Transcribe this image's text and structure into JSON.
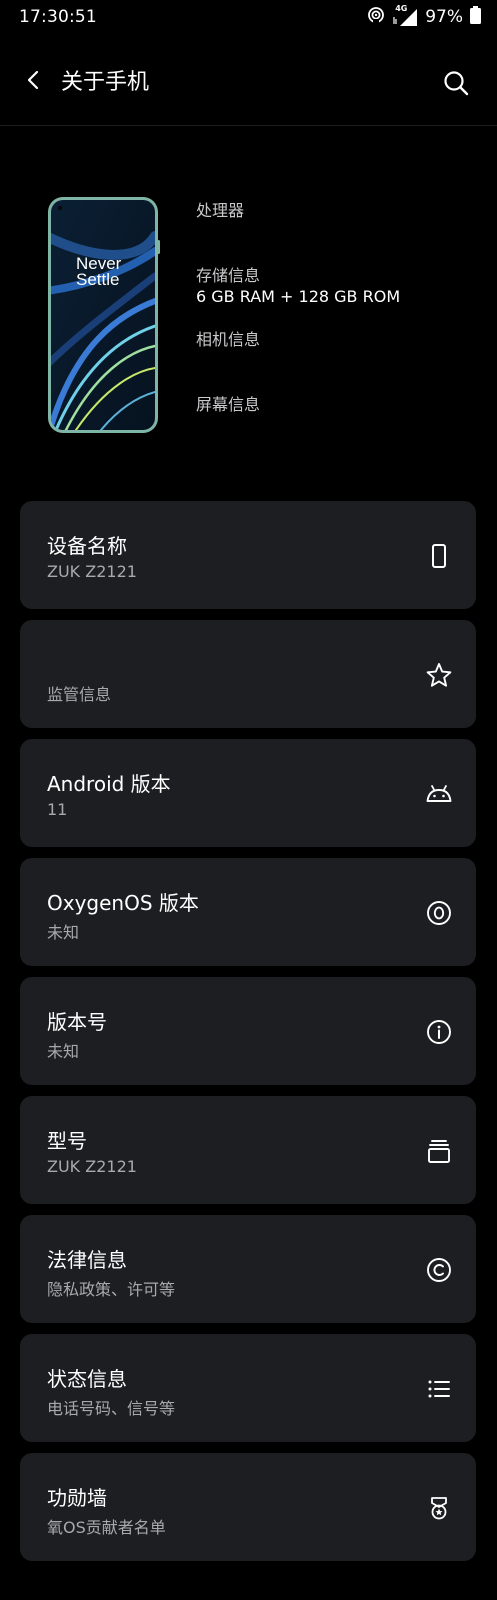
{
  "status_bar": {
    "time": "17:30:51",
    "network": "4G",
    "battery": "97%"
  },
  "header": {
    "title": "关于手机"
  },
  "phone_image": {
    "wallpaper_text_line1": "Never",
    "wallpaper_text_line2": "Settle"
  },
  "specs": {
    "processor_label": "处理器",
    "storage_label": "存储信息",
    "storage_value": "6 GB RAM + 128 GB ROM",
    "camera_label": "相机信息",
    "screen_label": "屏幕信息"
  },
  "cards": [
    {
      "title": "设备名称",
      "subtitle": "ZUK Z2121",
      "icon": "phone-icon"
    },
    {
      "title": "",
      "subtitle": "监管信息",
      "icon": "star-icon"
    },
    {
      "title": "Android 版本",
      "subtitle": "11",
      "icon": "android-icon"
    },
    {
      "title": "OxygenOS 版本",
      "subtitle": "未知",
      "icon": "oxygenos-icon"
    },
    {
      "title": "版本号",
      "subtitle": "未知",
      "icon": "info-icon"
    },
    {
      "title": "型号",
      "subtitle": "ZUK Z2121",
      "icon": "layers-icon"
    },
    {
      "title": "法律信息",
      "subtitle": "隐私政策、许可等",
      "icon": "copyright-icon"
    },
    {
      "title": "状态信息",
      "subtitle": "电话号码、信号等",
      "icon": "list-icon"
    },
    {
      "title": "功勋墙",
      "subtitle": "氧OS贡献者名单",
      "icon": "medal-icon"
    }
  ],
  "colors": {
    "background": "#000000",
    "card": "#1d1e21",
    "secondary_text": "#a8a9ad",
    "phone_frame": "#7fb5a6"
  }
}
